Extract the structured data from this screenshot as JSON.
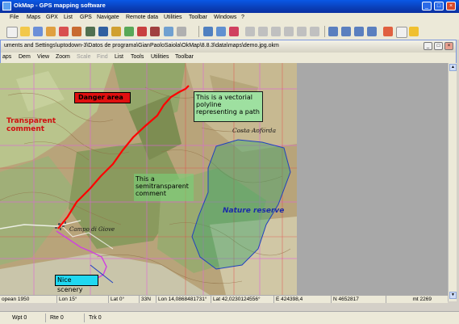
{
  "app": {
    "title": "OkMap - GPS mapping software",
    "window_buttons": [
      "_",
      "□",
      "×"
    ]
  },
  "menu": [
    "File",
    "Maps",
    "GPX",
    "List",
    "GPS",
    "Navigate",
    "Remote data",
    "Utilities",
    "Toolbar",
    "Windows",
    "?"
  ],
  "map_window": {
    "title": "uments and Settings\\uptodown-3\\Datos de programa\\GianPaoloSaiola\\OkMap\\8.8.3\\data\\maps\\demo.jpg.okm",
    "menu": [
      "aps",
      "Dem",
      "View",
      "Zoom",
      "Scale",
      "Find",
      "List",
      "Tools",
      "Utilities",
      "Toolbar"
    ],
    "disabled_menu": [
      "Scale",
      "Find"
    ]
  },
  "map": {
    "labels": {
      "danger_area": "Danger area",
      "transparent_comment": "Transparent comment",
      "vectorial_polyline": "This is a vectorial polyline representing a path",
      "semitransparent_comment": "This a semitransparent comment",
      "nature_reserve": "Nature reserve",
      "nice_scenery": "Nice scenery",
      "place_campo": "Campo di Giove",
      "place_costa": "Costa Aoforda"
    }
  },
  "inner_status": {
    "datum": "opean 1950",
    "lon": "Lon 15°",
    "lat": "Lat 0°",
    "zone": "33N",
    "lon_precise": "Lon 14,0868481731°",
    "lat_precise": "Lat 42,0230124556°",
    "easting": "E 424398,4",
    "northing": "N 4652817",
    "altitude": "mt 2269"
  },
  "outer_status": {
    "wpt": "Wpt 0",
    "rte": "Rte 0",
    "trk": "Trk 0"
  },
  "colors": {
    "title_bar": "#0a50d8",
    "danger_red": "#e01010",
    "nature_green": "#3fa36a",
    "scenery_cyan": "#20d8f0",
    "track_red": "#ff0000",
    "polygon_blue": "#2040c0",
    "path_magenta": "#d040e0"
  }
}
